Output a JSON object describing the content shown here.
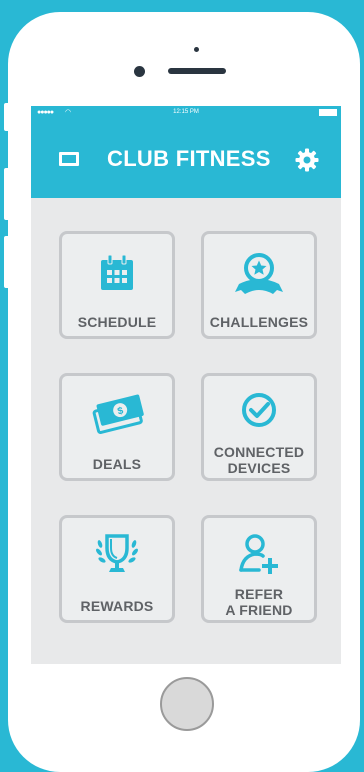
{
  "status_bar": {
    "time": "12:15 PM"
  },
  "app_bar": {
    "title": "CLUB FITNESS"
  },
  "tiles": [
    {
      "label": "SCHEDULE",
      "icon": "calendar-icon"
    },
    {
      "label": "CHALLENGES",
      "icon": "award-ribbon-icon"
    },
    {
      "label": "DEALS",
      "icon": "money-icon"
    },
    {
      "label_line1": "CONNECTED",
      "label_line2": "DEVICES",
      "icon": "checkmark-circle-icon"
    },
    {
      "label": "REWARDS",
      "icon": "trophy-icon"
    },
    {
      "label_line1": "REFER",
      "label_line2": "A FRIEND",
      "icon": "add-user-icon"
    }
  ],
  "colors": {
    "accent": "#29b8d4",
    "tile_border": "#c6c8cb",
    "label": "#5f6266",
    "screen_bg": "#e8e9ea"
  }
}
